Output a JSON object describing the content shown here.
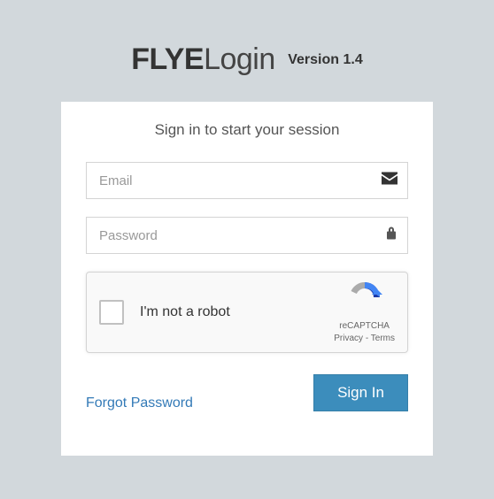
{
  "header": {
    "brand_bold": "FLYE",
    "brand_light": "Login",
    "version": "Version 1.4"
  },
  "login": {
    "subtitle": "Sign in to start your session",
    "email_placeholder": "Email",
    "password_placeholder": "Password",
    "recaptcha_label": "I'm not a robot",
    "recaptcha_name": "reCAPTCHA",
    "recaptcha_privacy": "Privacy",
    "recaptcha_terms": "Terms",
    "signin_label": "Sign In",
    "forgot_label": "Forgot Password"
  }
}
